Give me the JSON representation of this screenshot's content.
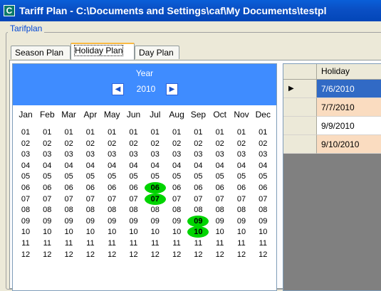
{
  "window": {
    "title": "Tariff Plan  - C:\\Documents and Settings\\caf\\My Documents\\testpl"
  },
  "groupbox": {
    "label": "Tarifplan"
  },
  "tabs": [
    {
      "label": "Season Plan",
      "active": false
    },
    {
      "label": "Holiday Plan",
      "active": true
    },
    {
      "label": "Day Plan",
      "active": false
    }
  ],
  "calendar": {
    "year_label": "Year",
    "year": "2010",
    "prev_icon": "left-arrow-icon",
    "next_icon": "right-arrow-icon",
    "header_color": "#3f8cff",
    "months": [
      "Jan",
      "Feb",
      "Mar",
      "Apr",
      "May",
      "Jun",
      "Jul",
      "Aug",
      "Sep",
      "Oct",
      "Nov",
      "Dec"
    ],
    "days": [
      "01",
      "02",
      "03",
      "04",
      "05",
      "06",
      "07",
      "08",
      "09",
      "10",
      "11",
      "12"
    ],
    "highlight_color": "#00d400",
    "highlights": [
      {
        "month": "Jul",
        "day": "06"
      },
      {
        "month": "Jul",
        "day": "07"
      },
      {
        "month": "Sep",
        "day": "09"
      },
      {
        "month": "Sep",
        "day": "10"
      }
    ]
  },
  "holiday_grid": {
    "column": "Holiday",
    "rows": [
      {
        "value": "7/6/2010",
        "current": true,
        "style": "selected"
      },
      {
        "value": "7/7/2010",
        "current": false,
        "style": "alt"
      },
      {
        "value": "9/9/2010",
        "current": false,
        "style": "plain"
      },
      {
        "value": "9/10/2010",
        "current": false,
        "style": "alt"
      }
    ],
    "colors": {
      "selected": "#316ac5",
      "alt": "#fadcc0",
      "plain": "#ffffff"
    }
  }
}
